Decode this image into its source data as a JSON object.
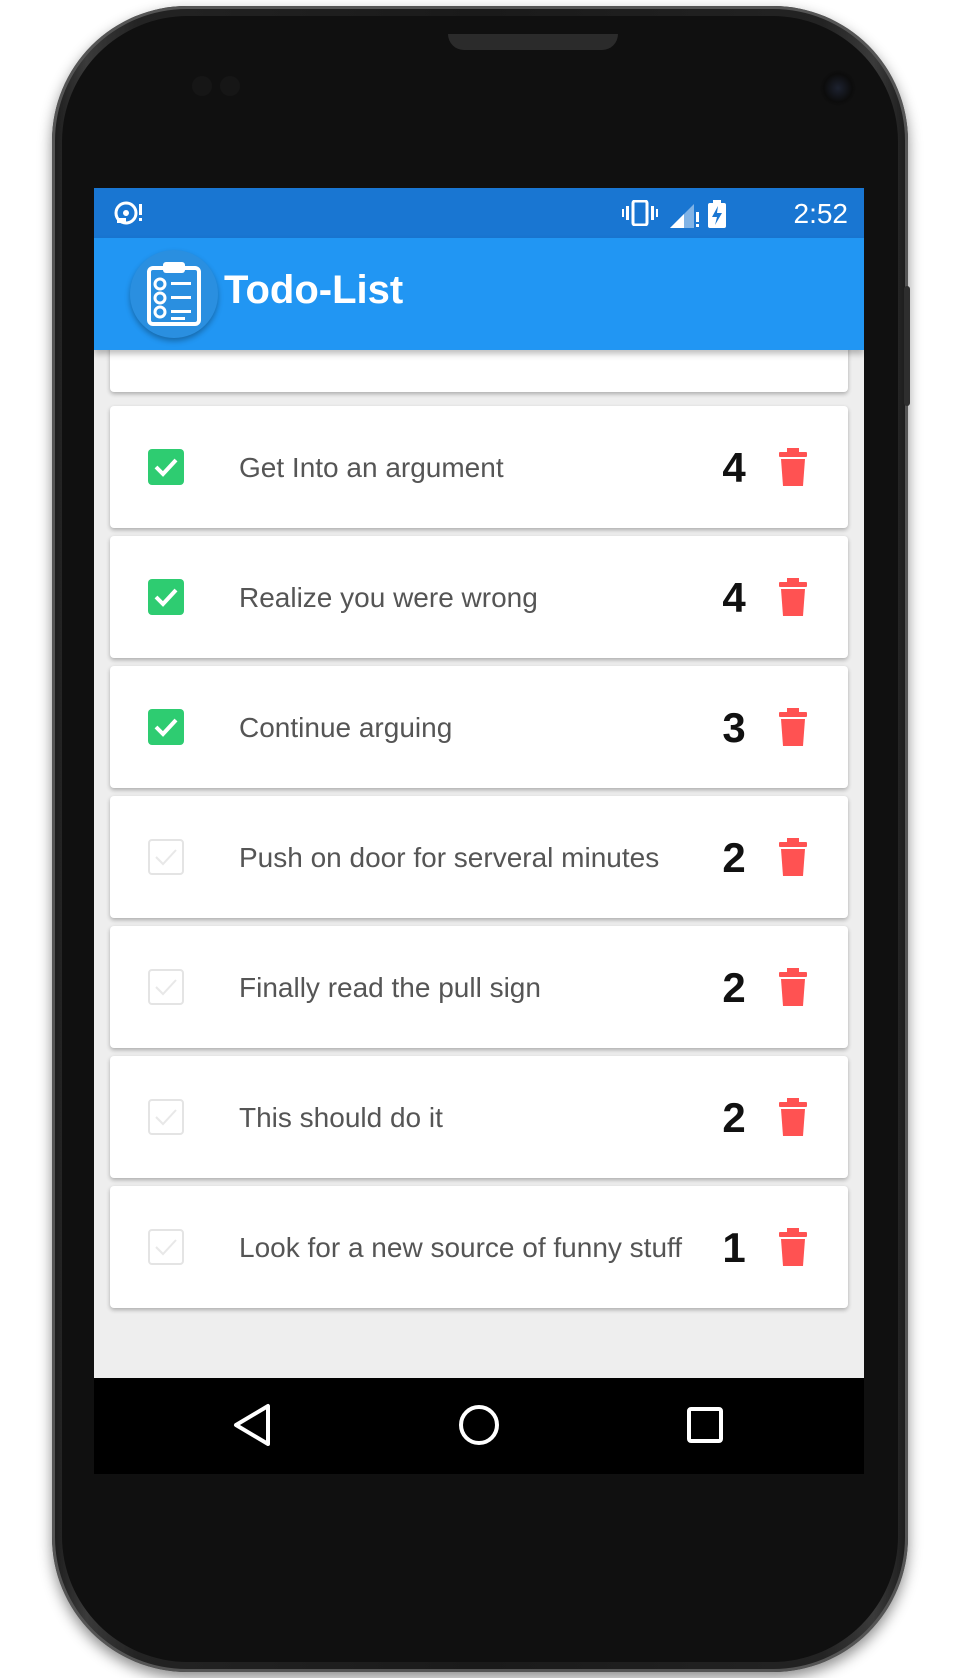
{
  "status_bar": {
    "time": "2:52",
    "icons": [
      "notification-icon",
      "vibrate-icon",
      "signal-icon",
      "battery-charging-icon"
    ]
  },
  "app_bar": {
    "title": "Todo-List",
    "logo_icon": "clipboard-checklist-icon"
  },
  "colors": {
    "status_bar": "#1976d2",
    "app_bar": "#2196f3",
    "check_accent": "#2ecc71",
    "delete_icon": "#ff5252",
    "background": "#eeeeee"
  },
  "tasks": [
    {
      "text": "Get Into an argument",
      "priority": "4",
      "checked": true
    },
    {
      "text": "Realize you were wrong",
      "priority": "4",
      "checked": true
    },
    {
      "text": "Continue arguing",
      "priority": "3",
      "checked": true
    },
    {
      "text": "Push on door for serveral minutes",
      "priority": "2",
      "checked": false
    },
    {
      "text": "Finally read the pull sign",
      "priority": "2",
      "checked": false
    },
    {
      "text": "This should do it",
      "priority": "2",
      "checked": false
    },
    {
      "text": "Look for a new source of funny stuff",
      "priority": "1",
      "checked": false
    }
  ],
  "nav_bar": {
    "buttons": [
      "back-icon",
      "home-icon",
      "recents-icon"
    ]
  }
}
